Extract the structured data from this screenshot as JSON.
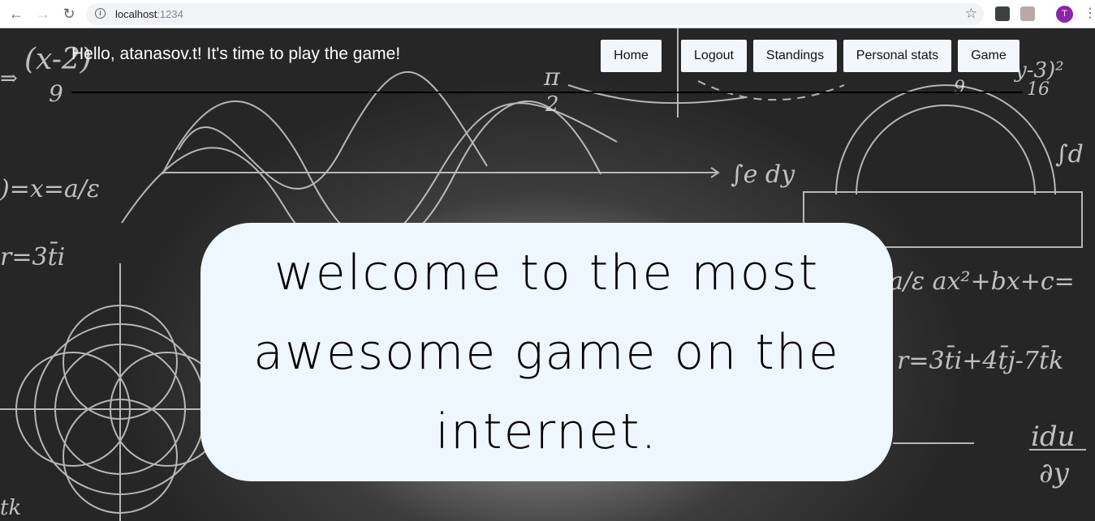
{
  "browser": {
    "url_host": "localhost",
    "url_port": ":1234",
    "avatar_initial": "T"
  },
  "header": {
    "greeting": "Hello, atanasov.t! It's time to play the game!"
  },
  "nav": {
    "home": "Home",
    "logout": "Logout",
    "standings": "Standings",
    "personal_stats": "Personal stats",
    "game": "Game"
  },
  "hero": {
    "message": "welcome to the most awesome game on the internet."
  },
  "colors": {
    "panel_bg": "#eef6ff",
    "button_bg": "#f3f6fa",
    "avatar_bg": "#8e24aa"
  }
}
